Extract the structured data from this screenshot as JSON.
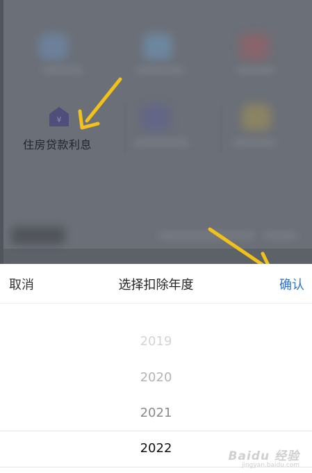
{
  "background": {
    "item_label": "住房贷款利息",
    "item_icon": "house-yuan-icon",
    "icon_color": "#4f4e7a",
    "overlay_color": "#5d6168"
  },
  "sheet": {
    "cancel_label": "取消",
    "title": "选择扣除年度",
    "confirm_label": "确认",
    "confirm_color": "#2f6fd8"
  },
  "picker": {
    "years": [
      "2019",
      "2020",
      "2021",
      "2022"
    ],
    "selected": "2022"
  },
  "annotation": {
    "arrow_color": "#f2c11a"
  },
  "watermark": {
    "brand": "Baidu 经验",
    "url": "jingyan.baidu.com"
  }
}
